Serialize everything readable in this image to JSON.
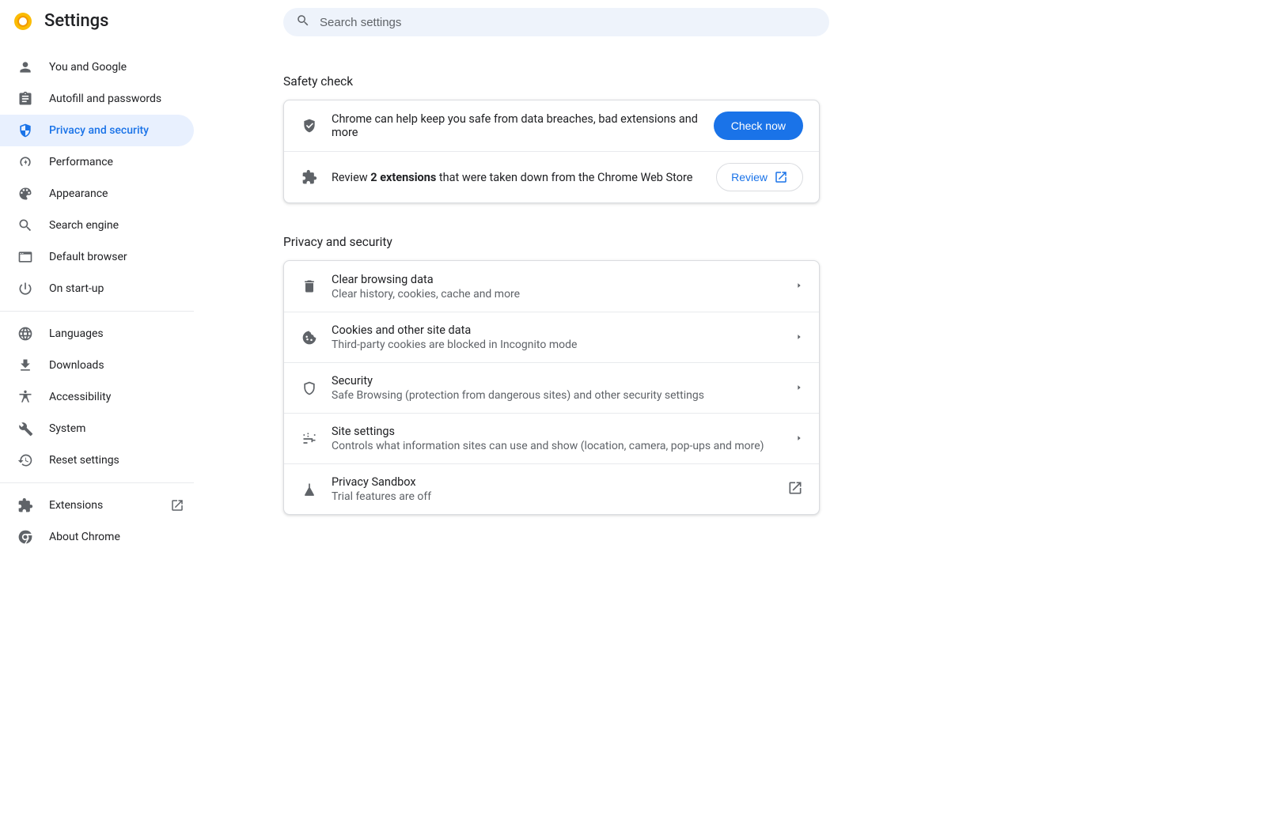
{
  "app": {
    "title": "Settings"
  },
  "search": {
    "placeholder": "Search settings"
  },
  "sidebar": {
    "items": [
      {
        "label": "You and Google"
      },
      {
        "label": "Autofill and passwords"
      },
      {
        "label": "Privacy and security"
      },
      {
        "label": "Performance"
      },
      {
        "label": "Appearance"
      },
      {
        "label": "Search engine"
      },
      {
        "label": "Default browser"
      },
      {
        "label": "On start-up"
      },
      {
        "label": "Languages"
      },
      {
        "label": "Downloads"
      },
      {
        "label": "Accessibility"
      },
      {
        "label": "System"
      },
      {
        "label": "Reset settings"
      },
      {
        "label": "Extensions"
      },
      {
        "label": "About Chrome"
      }
    ]
  },
  "safety": {
    "heading": "Safety check",
    "row1_text": "Chrome can help keep you safe from data breaches, bad extensions and more",
    "check_button": "Check now",
    "row2_prefix": "Review ",
    "row2_bold": "2 extensions",
    "row2_suffix": " that were taken down from the Chrome Web Store",
    "review_button": "Review"
  },
  "privacy": {
    "heading": "Privacy and security",
    "items": [
      {
        "title": "Clear browsing data",
        "sub": "Clear history, cookies, cache and more"
      },
      {
        "title": "Cookies and other site data",
        "sub": "Third-party cookies are blocked in Incognito mode"
      },
      {
        "title": "Security",
        "sub": "Safe Browsing (protection from dangerous sites) and other security settings"
      },
      {
        "title": "Site settings",
        "sub": "Controls what information sites can use and show (location, camera, pop-ups and more)"
      },
      {
        "title": "Privacy Sandbox",
        "sub": "Trial features are off"
      }
    ]
  }
}
